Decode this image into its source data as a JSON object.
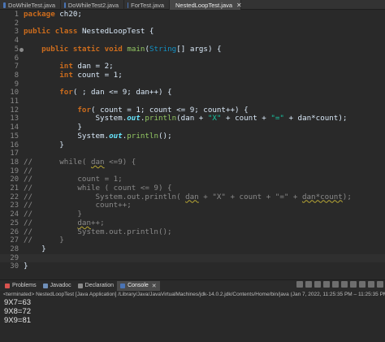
{
  "tabs": [
    {
      "label": "DoWhileTest.java",
      "active": false
    },
    {
      "label": "DoWhileTest2.java",
      "active": false
    },
    {
      "label": "ForTest.java",
      "active": false
    },
    {
      "label": "NestedLoopTest.java",
      "active": true
    }
  ],
  "tab_close_glyph": "✕",
  "code": [
    {
      "n": "1",
      "t": "package ch20;"
    },
    {
      "n": "2",
      "t": ""
    },
    {
      "n": "3",
      "t": "public class NestedLoopTest {"
    },
    {
      "n": "4",
      "t": ""
    },
    {
      "n": "5",
      "t": "    public static void main(String[] args) {"
    },
    {
      "n": "6",
      "t": ""
    },
    {
      "n": "7",
      "t": "        int dan = 2;"
    },
    {
      "n": "8",
      "t": "        int count = 1;"
    },
    {
      "n": "9",
      "t": ""
    },
    {
      "n": "10",
      "t": "        for( ; dan <= 9; dan++) {"
    },
    {
      "n": "11",
      "t": ""
    },
    {
      "n": "12",
      "t": "            for( count = 1; count <= 9; count++) {"
    },
    {
      "n": "13",
      "t": "                System.out.println(dan + \"X\" + count + \"=\" + dan*count);"
    },
    {
      "n": "14",
      "t": "            }"
    },
    {
      "n": "15",
      "t": "            System.out.println();"
    },
    {
      "n": "16",
      "t": "        }"
    },
    {
      "n": "17",
      "t": ""
    },
    {
      "n": "18",
      "t": "//      while( dan <=9) {"
    },
    {
      "n": "19",
      "t": "//"
    },
    {
      "n": "20",
      "t": "//          count = 1;"
    },
    {
      "n": "21",
      "t": "//          while ( count <= 9) {"
    },
    {
      "n": "22",
      "t": "//              System.out.println( dan + \"X\" + count + \"=\" + dan*count);"
    },
    {
      "n": "23",
      "t": "//              count++;"
    },
    {
      "n": "24",
      "t": "//          }"
    },
    {
      "n": "25",
      "t": "//          dan++;"
    },
    {
      "n": "26",
      "t": "//          System.out.println();"
    },
    {
      "n": "27",
      "t": "//      }"
    },
    {
      "n": "28",
      "t": "    }"
    },
    {
      "n": "29",
      "t": ""
    },
    {
      "n": "30",
      "t": "}"
    }
  ],
  "view_tabs": [
    {
      "label": "Problems",
      "icon": "problems-icon",
      "color": "#d9534f",
      "active": false
    },
    {
      "label": "Javadoc",
      "icon": "javadoc-icon",
      "color": "#6f8fb9",
      "active": false
    },
    {
      "label": "Declaration",
      "icon": "declaration-icon",
      "color": "#8b8b8b",
      "active": false
    },
    {
      "label": "Console",
      "icon": "console-icon",
      "color": "#4a74b5",
      "active": true
    }
  ],
  "console": {
    "header": "<terminated> NestedLoopTest [Java Application] /Library/Java/JavaVirtualMachines/jdk-14.0.2.jdk/Contents/Home/bin/java  (Jan 7, 2022, 11:25:35 PM – 11:25:35 PM)",
    "output": [
      "9X7=63",
      "9X8=72",
      "9X9=81"
    ]
  },
  "colors": {
    "background": "#292929",
    "keyword": "#cc6c1d",
    "string": "#17c6a3",
    "field": "#66e1f8",
    "comment": "#8a8a8a"
  }
}
